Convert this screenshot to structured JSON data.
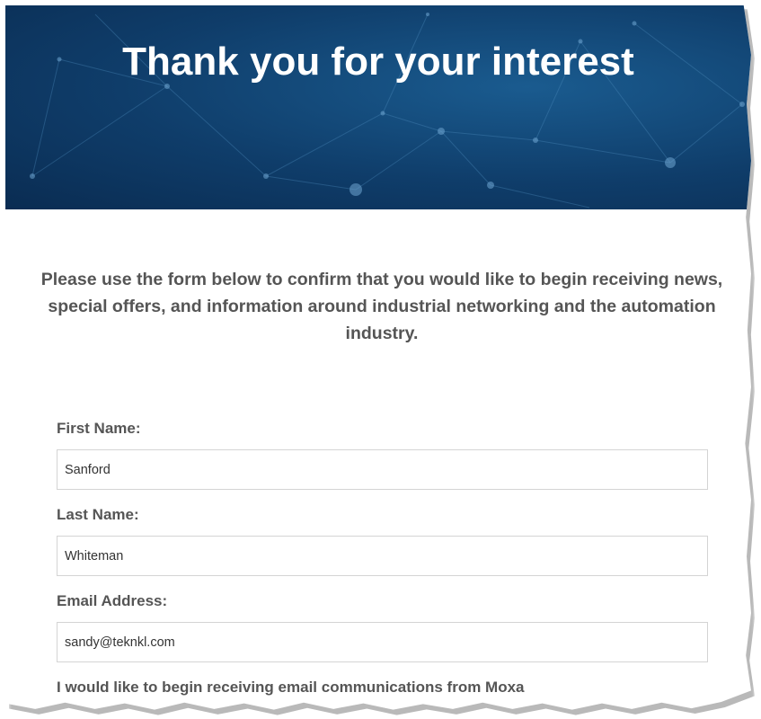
{
  "hero": {
    "title": "Thank you for your interest"
  },
  "intro": {
    "text": "Please use the form below to confirm that you would like to begin receiving news, special offers, and information around industrial networking and the automation industry."
  },
  "form": {
    "first_name": {
      "label": "First Name:",
      "value": "Sanford"
    },
    "last_name": {
      "label": "Last Name:",
      "value": "Whiteman"
    },
    "email": {
      "label": "Email Address:",
      "value": "sandy@teknkl.com"
    },
    "optin_label": "I would like to begin receiving email communications from Moxa"
  },
  "colors": {
    "hero_background": "#0f3d6a",
    "text": "#555555",
    "input_border": "#d4d4d4"
  }
}
